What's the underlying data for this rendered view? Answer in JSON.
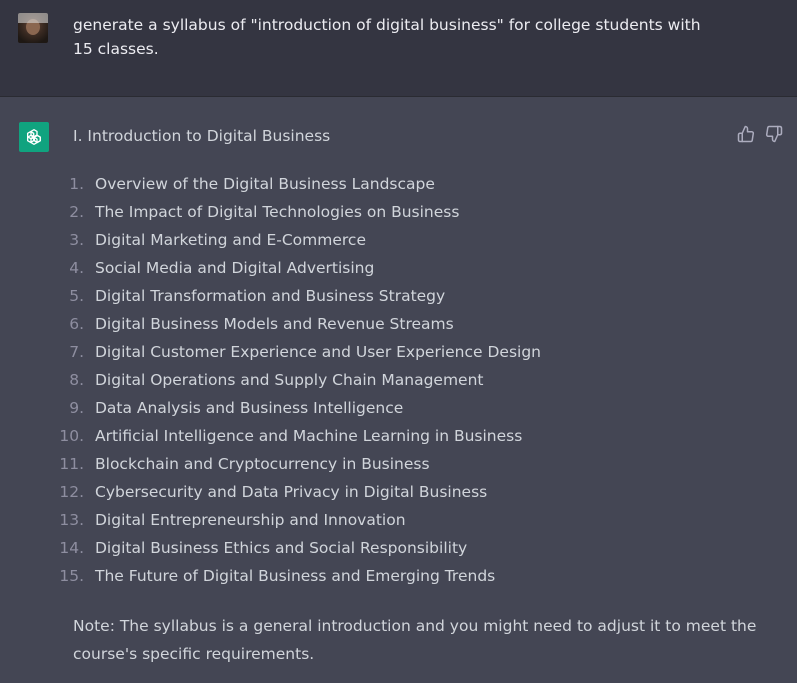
{
  "user_message": {
    "text": "generate a syllabus of \"introduction of digital business\" for college students with 15 classes."
  },
  "assistant_message": {
    "heading": "I. Introduction to Digital Business",
    "items": [
      {
        "num": "1.",
        "text": "Overview of the Digital Business Landscape"
      },
      {
        "num": "2.",
        "text": "The Impact of Digital Technologies on Business"
      },
      {
        "num": "3.",
        "text": "Digital Marketing and E-Commerce"
      },
      {
        "num": "4.",
        "text": "Social Media and Digital Advertising"
      },
      {
        "num": "5.",
        "text": "Digital Transformation and Business Strategy"
      },
      {
        "num": "6.",
        "text": "Digital Business Models and Revenue Streams"
      },
      {
        "num": "7.",
        "text": "Digital Customer Experience and User Experience Design"
      },
      {
        "num": "8.",
        "text": "Digital Operations and Supply Chain Management"
      },
      {
        "num": "9.",
        "text": "Data Analysis and Business Intelligence"
      },
      {
        "num": "10.",
        "text": "Artificial Intelligence and Machine Learning in Business"
      },
      {
        "num": "11.",
        "text": "Blockchain and Cryptocurrency in Business"
      },
      {
        "num": "12.",
        "text": "Cybersecurity and Data Privacy in Digital Business"
      },
      {
        "num": "13.",
        "text": "Digital Entrepreneurship and Innovation"
      },
      {
        "num": "14.",
        "text": "Digital Business Ethics and Social Responsibility"
      },
      {
        "num": "15.",
        "text": "The Future of Digital Business and Emerging Trends"
      }
    ],
    "note": "Note: The syllabus is a general introduction and you might need to adjust it to meet the course's specific requirements."
  },
  "icons": {
    "assistant_avatar": "openai-logo-icon",
    "thumbs_up": "thumbs-up-icon",
    "thumbs_down": "thumbs-down-icon"
  },
  "colors": {
    "user_bg": "#343541",
    "assistant_bg": "#444654",
    "assistant_icon_bg": "#10a37f",
    "text": "#d1d5db"
  }
}
